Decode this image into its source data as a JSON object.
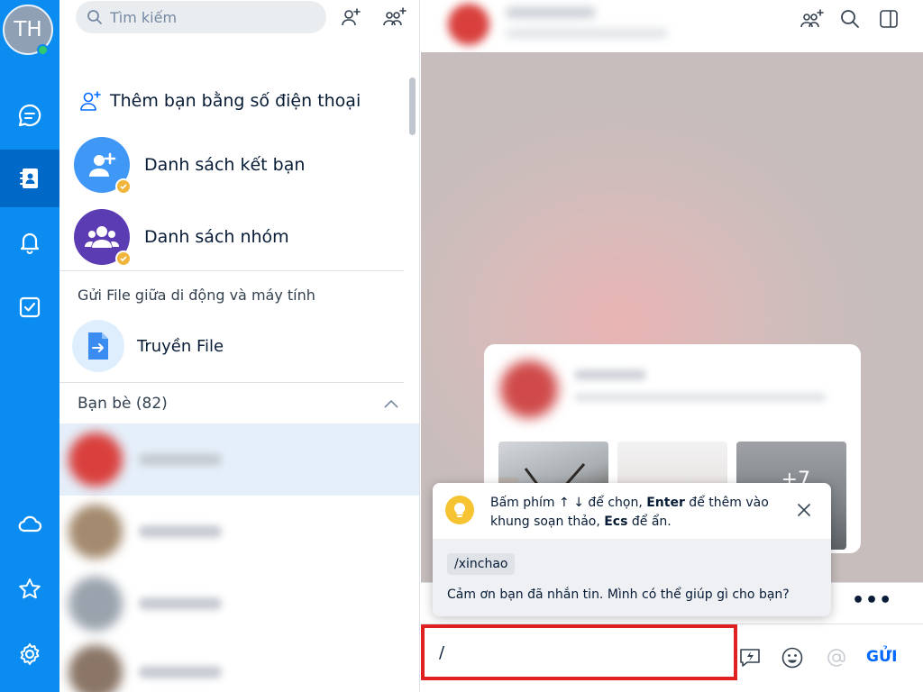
{
  "user": {
    "initials": "TH"
  },
  "nav": {
    "items": [
      {
        "id": "messages",
        "icon": "chat-bubble-icon"
      },
      {
        "id": "contacts",
        "icon": "contact-book-icon",
        "active": true
      },
      {
        "id": "notifications",
        "icon": "bell-icon"
      },
      {
        "id": "todo",
        "icon": "checkbox-icon"
      },
      {
        "id": "cloud",
        "icon": "cloud-icon"
      },
      {
        "id": "starred",
        "icon": "star-icon"
      },
      {
        "id": "settings",
        "icon": "gear-icon"
      }
    ]
  },
  "search": {
    "placeholder": "Tìm kiếm"
  },
  "contacts_panel": {
    "add_by_phone": "Thêm bạn bằng số điện thoại",
    "friend_list": "Danh sách kết bạn",
    "group_list": "Danh sách nhóm",
    "file_section_label": "Gửi File giữa di động và máy tính",
    "file_transfer": "Truyền File",
    "friends_header": "Bạn bè (82)"
  },
  "quick_message_popup": {
    "hint_part1": "Bấm phím ↑ ↓ để chọn, ",
    "hint_enter": "Enter",
    "hint_part2": " để thêm vào khung soạn thảo, ",
    "hint_esc": "Ecs",
    "hint_part3": " để ẩn.",
    "shortcut": "/xinchao",
    "message": "Cảm ơn bạn đã nhắn tin. Mình có thể giúp gì cho bạn?"
  },
  "composer": {
    "value": "/",
    "send_label": "GỬI"
  },
  "media_card": {
    "extra_count": "+7"
  },
  "colors": {
    "brand": "#0a8cf0",
    "nav_active": "#0068c7",
    "highlight_border": "#e02121",
    "send": "#0068ff"
  }
}
